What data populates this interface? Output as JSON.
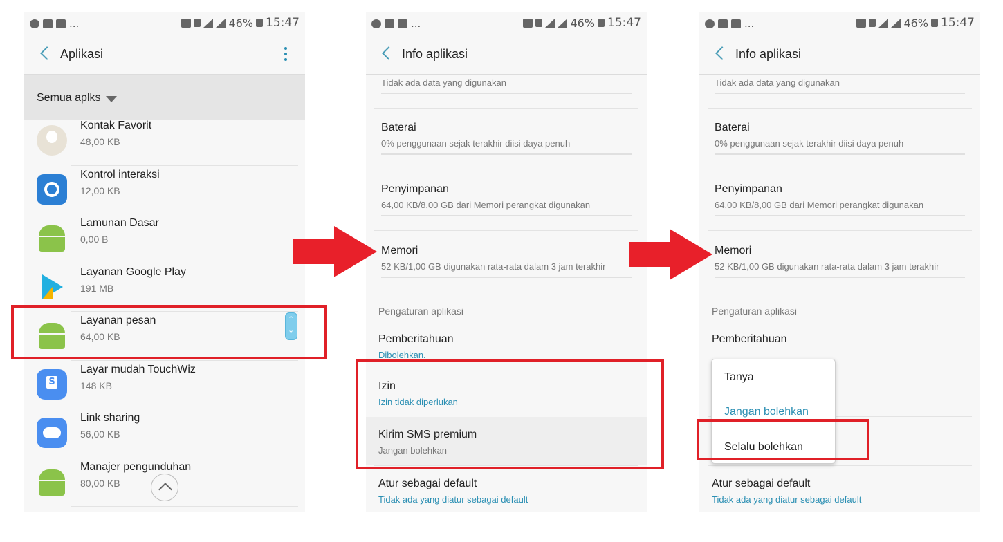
{
  "status": {
    "battery": "46%",
    "time": "15:47"
  },
  "screen1": {
    "title": "Aplikasi",
    "filter": "Semua aplks",
    "apps": [
      {
        "name": "Kontak Favorit",
        "size": "48,00 KB",
        "icon": "contact-icon"
      },
      {
        "name": "Kontrol interaksi",
        "size": "12,00 KB",
        "icon": "gear-icon"
      },
      {
        "name": "Lamunan Dasar",
        "size": "0,00 B",
        "icon": "android-icon"
      },
      {
        "name": "Layanan Google Play",
        "size": "191 MB",
        "icon": "google-play-services-icon"
      },
      {
        "name": "Layanan pesan",
        "size": "64,00 KB",
        "icon": "android-icon"
      },
      {
        "name": "Layar mudah TouchWiz",
        "size": "148 KB",
        "icon": "touchwiz-icon"
      },
      {
        "name": "Link sharing",
        "size": "56,00 KB",
        "icon": "cloud-link-icon"
      },
      {
        "name": "Manajer pengunduhan",
        "size": "80,00 KB",
        "icon": "android-icon"
      }
    ]
  },
  "info": {
    "title": "Info aplikasi",
    "data_usage": "Tidak ada data yang digunakan",
    "battery_title": "Baterai",
    "battery_sub": "0% penggunaan sejak terakhir diisi daya penuh",
    "storage_title": "Penyimpanan",
    "storage_sub": "64,00 KB/8,00 GB dari Memori perangkat digunakan",
    "memory_title": "Memori",
    "memory_sub": "52 KB/1,00 GB digunakan rata-rata dalam 3 jam terakhir",
    "section": "Pengaturan aplikasi",
    "notif_title": "Pemberitahuan",
    "notif_sub": "Dibolehkan.",
    "perm_title": "Izin",
    "perm_sub": "Izin tidak diperlukan",
    "sms_title": "Kirim SMS premium",
    "sms_sub": "Jangan bolehkan",
    "default_title": "Atur sebagai default",
    "default_sub": "Tidak ada yang diatur sebagai default"
  },
  "popup": {
    "options": [
      "Tanya",
      "Jangan bolehkan",
      "Selalu bolehkan"
    ]
  },
  "colors": {
    "accent": "#2b8fb3",
    "highlight": "#e02028",
    "arrow": "#e8202a"
  }
}
